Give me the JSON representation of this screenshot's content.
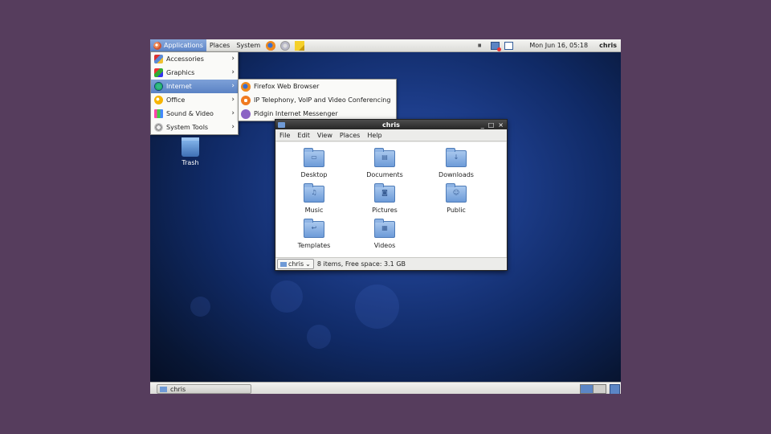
{
  "top_panel": {
    "menus": [
      "Applications",
      "Places",
      "System"
    ],
    "clock": "Mon Jun 16, 05:18",
    "user": "chris"
  },
  "app_menu": {
    "items": [
      {
        "label": "Accessories",
        "icon": "accessories-icon"
      },
      {
        "label": "Graphics",
        "icon": "graphics-icon"
      },
      {
        "label": "Internet",
        "icon": "internet-icon"
      },
      {
        "label": "Office",
        "icon": "office-icon"
      },
      {
        "label": "Sound & Video",
        "icon": "sound-video-icon"
      },
      {
        "label": "System Tools",
        "icon": "system-tools-icon"
      }
    ],
    "active": "Internet"
  },
  "internet_submenu": {
    "items": [
      {
        "label": "Firefox Web Browser",
        "icon": "firefox-icon"
      },
      {
        "label": "IP Telephony, VoIP and Video Conferencing",
        "icon": "ekiga-icon"
      },
      {
        "label": "Pidgin Internet Messenger",
        "icon": "pidgin-icon"
      }
    ]
  },
  "desktop": {
    "icons": [
      {
        "label": "Trash",
        "icon": "trash-icon"
      }
    ]
  },
  "window": {
    "title": "chris",
    "menubar": [
      "File",
      "Edit",
      "View",
      "Places",
      "Help"
    ],
    "folders": [
      {
        "label": "Desktop",
        "icon": "desktop-folder-icon"
      },
      {
        "label": "Documents",
        "icon": "documents-folder-icon"
      },
      {
        "label": "Downloads",
        "icon": "downloads-folder-icon"
      },
      {
        "label": "Music",
        "icon": "music-folder-icon"
      },
      {
        "label": "Pictures",
        "icon": "pictures-folder-icon"
      },
      {
        "label": "Public",
        "icon": "public-folder-icon"
      },
      {
        "label": "Templates",
        "icon": "templates-folder-icon"
      },
      {
        "label": "Videos",
        "icon": "videos-folder-icon"
      }
    ],
    "location": "chris",
    "status": "8 items, Free space: 3.1 GB"
  },
  "bottom_panel": {
    "task_label": "chris"
  },
  "colors": {
    "outer_background": "#563d5d",
    "menu_highlight": "#5e86c8",
    "folder_blue": "#6d9bd8"
  }
}
